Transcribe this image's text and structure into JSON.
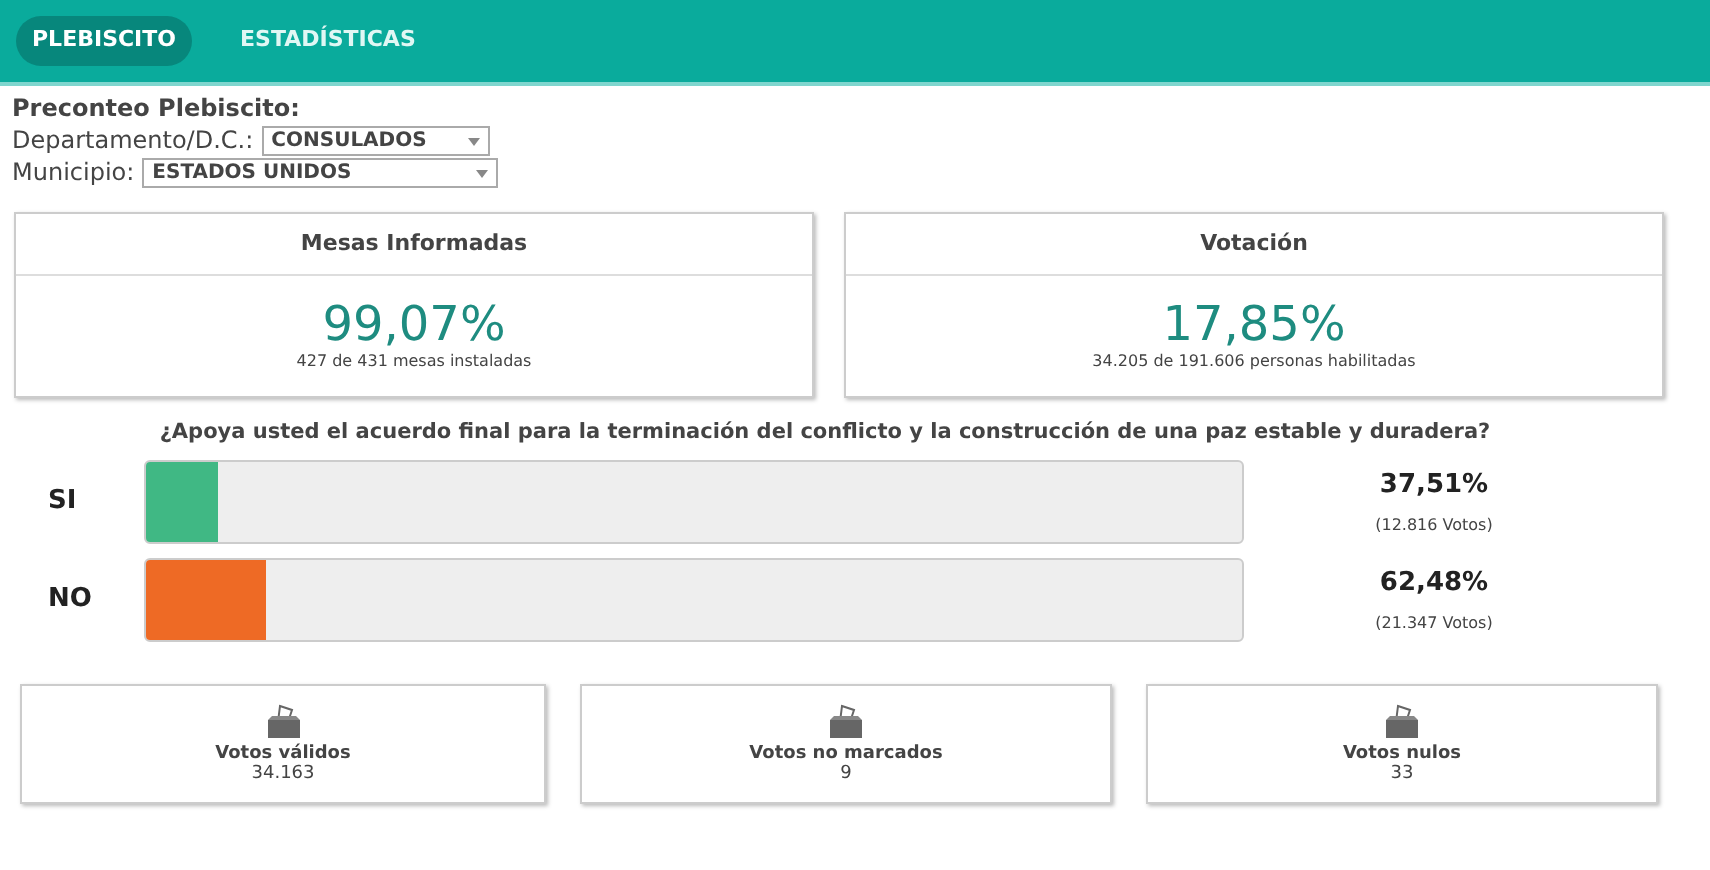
{
  "nav": {
    "tabs": [
      {
        "label": "PLEBISCITO",
        "selected": true
      },
      {
        "label": "ESTADÍSTICAS",
        "selected": false
      }
    ]
  },
  "filters": {
    "title": "Preconteo Plebiscito:",
    "fields": [
      {
        "label": "Departamento/D.C.:",
        "value": "CONSULADOS"
      },
      {
        "label": "Municipio:",
        "value": "ESTADOS UNIDOS"
      }
    ]
  },
  "summary_cards": [
    {
      "title": "Mesas Informadas",
      "value": "99,07%",
      "detail": "427 de 431 mesas instaladas"
    },
    {
      "title": "Votación",
      "value": "17,85%",
      "detail": "34.205 de 191.606 personas habilitadas"
    }
  ],
  "question": "¿Apoya usted el acuerdo final para la terminación del conflicto y la construcción de una paz estable y duradera?",
  "options": [
    {
      "label": "SI",
      "level": 0.065,
      "color": "#40b884",
      "percent": "37,51%",
      "votes": "(12.816 Votos)"
    },
    {
      "label": "NO",
      "level": 0.11,
      "color": "#ee6a25",
      "percent": "62,48%",
      "votes": "(21.347 Votos)"
    }
  ],
  "vote_cards": [
    {
      "title": "Votos válidos",
      "count": "34.163"
    },
    {
      "title": "Votos no marcados",
      "count": "9"
    },
    {
      "title": "Votos nulos",
      "count": "33"
    }
  ]
}
